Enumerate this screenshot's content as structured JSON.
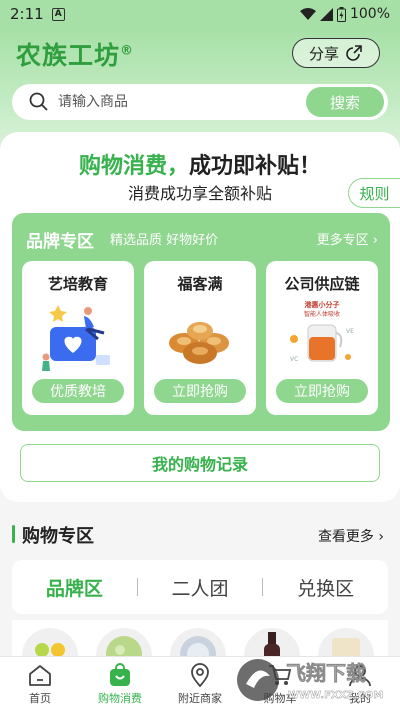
{
  "status_bar": {
    "time": "2:11",
    "notification_badge": "A",
    "battery": "100%"
  },
  "app": {
    "logo_text": "农族工坊",
    "logo_mark": "®",
    "share_label": "分享"
  },
  "search": {
    "placeholder": "请输入商品",
    "button_label": "搜索"
  },
  "promo": {
    "title_green": "购物消费，",
    "title_dark": "成功即补贴！",
    "subtitle": "消费成功享全额补贴",
    "rules_label": "规则"
  },
  "brand_zone": {
    "title": "品牌专区",
    "subtitle": "精选品质 好物好价",
    "more_label": "更多专区",
    "cards": [
      {
        "name": "艺培教育",
        "button": "优质教培"
      },
      {
        "name": "福客满",
        "button": "立即抢购"
      },
      {
        "name": "公司供应链",
        "button": "立即抢购",
        "image_text_1": "港惠小分子",
        "image_text_2": "智能人体吸收"
      }
    ]
  },
  "records_button": "我的购物记录",
  "shopping_zone": {
    "title": "购物专区",
    "more_label": "查看更多"
  },
  "tabs": [
    {
      "label": "品牌区",
      "active": true
    },
    {
      "label": "二人团",
      "active": false
    },
    {
      "label": "兑换区",
      "active": false
    }
  ],
  "bottom_nav": [
    {
      "label": "首页",
      "icon": "home-icon",
      "active": false
    },
    {
      "label": "购物消费",
      "icon": "shopping-bag-icon",
      "active": true
    },
    {
      "label": "附近商家",
      "icon": "location-pin-icon",
      "active": false
    },
    {
      "label": "购物车",
      "icon": "cart-icon",
      "active": false
    },
    {
      "label": "我的",
      "icon": "user-icon",
      "active": false
    }
  ],
  "watermark": {
    "brand": "飞翔下载",
    "url": "WWW.FXXZ.COM"
  },
  "colors": {
    "accent": "#37b24d",
    "accent_light": "#8fd68f",
    "header_bg": "#a6e0a6"
  }
}
